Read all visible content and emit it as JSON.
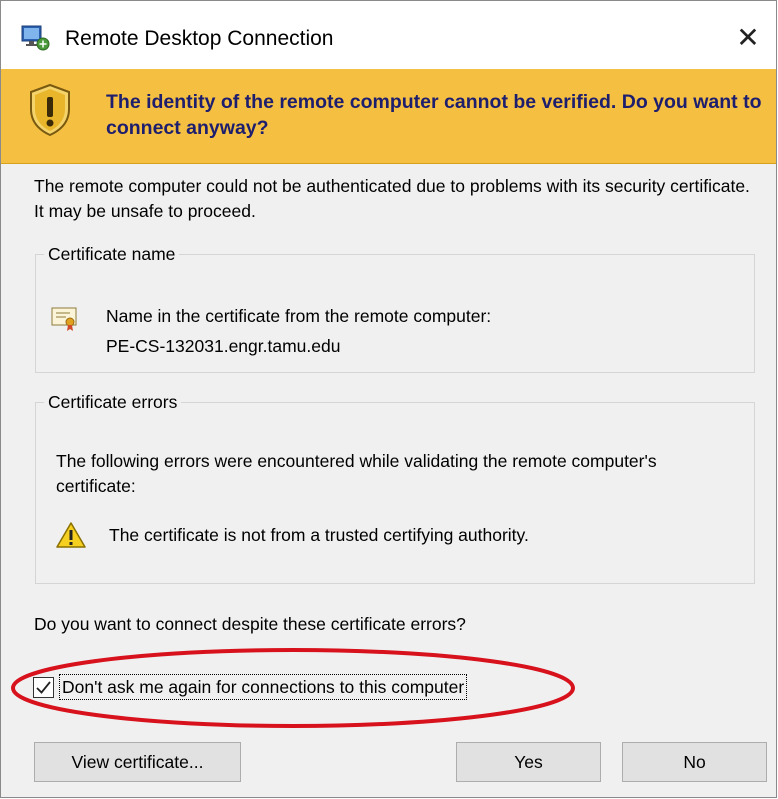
{
  "window": {
    "title": "Remote Desktop Connection",
    "close_glyph": "✕",
    "app_icon": "remote-desktop-icon"
  },
  "banner": {
    "icon": "security-warning-shield-icon",
    "message": "The identity of the remote computer cannot be verified. Do you want to connect anyway?",
    "color": "#f5c042"
  },
  "intro": "The remote computer could not be authenticated due to problems with its security certificate. It may be unsafe to proceed.",
  "certificate_name": {
    "legend": "Certificate name",
    "icon": "certificate-icon",
    "label": "Name in the certificate from the remote computer:",
    "value": "PE-CS-132031.engr.tamu.edu"
  },
  "certificate_errors": {
    "legend": "Certificate errors",
    "description": "The following errors were encountered while validating the remote computer's certificate:",
    "items": [
      {
        "icon": "warning-icon",
        "text": "The certificate is not from a trusted certifying authority."
      }
    ]
  },
  "question": "Do you want to connect despite these certificate errors?",
  "dont_ask": {
    "label": "Don't ask me again for connections to this computer",
    "checked": true,
    "highlight_color": "#d8121c"
  },
  "buttons": {
    "view_certificate": "View certificate...",
    "yes": "Yes",
    "no": "No"
  }
}
